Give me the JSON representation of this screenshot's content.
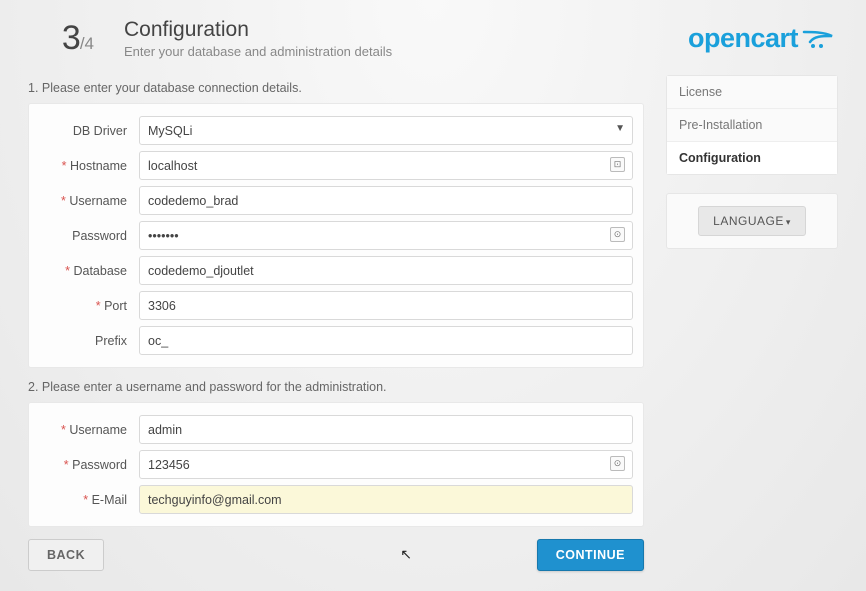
{
  "step": {
    "current": "3",
    "total": "/4"
  },
  "header": {
    "title": "Configuration",
    "subtitle": "Enter your database and administration details",
    "logo": "opencart"
  },
  "sections": {
    "db_heading": "1. Please enter your database connection details.",
    "admin_heading": "2. Please enter a username and password for the administration."
  },
  "db": {
    "driver_label": "DB Driver",
    "driver_value": "MySQLi",
    "hostname_label": "Hostname",
    "hostname_value": "localhost",
    "username_label": "Username",
    "username_value": "codedemo_brad",
    "password_label": "Password",
    "password_value": "•••••••",
    "database_label": "Database",
    "database_value": "codedemo_djoutlet",
    "port_label": "Port",
    "port_value": "3306",
    "prefix_label": "Prefix",
    "prefix_value": "oc_"
  },
  "admin": {
    "username_label": "Username",
    "username_value": "admin",
    "password_label": "Password",
    "password_value": "123456",
    "email_label": "E-Mail",
    "email_value": "techguyinfo@gmail.com"
  },
  "sidebar": {
    "items": [
      "License",
      "Pre-Installation",
      "Configuration"
    ],
    "language_label": "LANGUAGE"
  },
  "buttons": {
    "back": "BACK",
    "continue": "CONTINUE"
  }
}
